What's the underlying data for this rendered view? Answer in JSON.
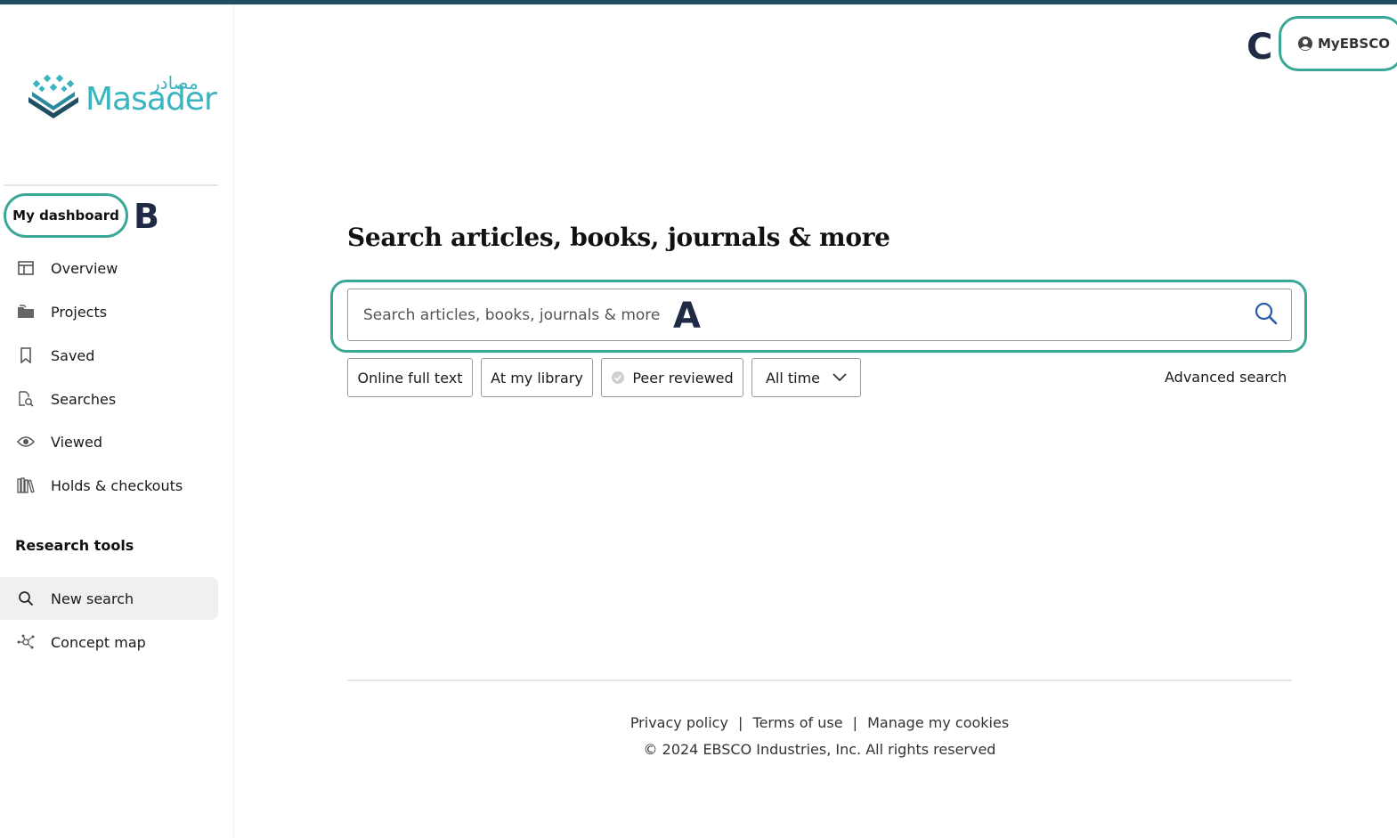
{
  "logo": {
    "arabic_text": "مصادر",
    "english_text": "Masader"
  },
  "sidebar": {
    "dashboard_label": "My dashboard",
    "items": [
      {
        "label": "Overview",
        "icon": "overview-icon"
      },
      {
        "label": "Projects",
        "icon": "folder-icon"
      },
      {
        "label": "Saved",
        "icon": "bookmark-icon"
      },
      {
        "label": "Searches",
        "icon": "search-history-icon"
      },
      {
        "label": "Viewed",
        "icon": "eye-icon"
      },
      {
        "label": "Holds & checkouts",
        "icon": "books-icon"
      }
    ],
    "research_tools_title": "Research tools",
    "tools": [
      {
        "label": "New search",
        "icon": "search-icon",
        "active": true
      },
      {
        "label": "Concept map",
        "icon": "concept-map-icon",
        "active": false
      }
    ]
  },
  "annotations": {
    "a": "A",
    "b": "B",
    "c": "C"
  },
  "header": {
    "myebsco_label": "MyEBSCO"
  },
  "main": {
    "title": "Search articles, books, journals & more",
    "search_placeholder": "Search articles, books, journals & more",
    "filters": [
      {
        "label": "Online full text"
      },
      {
        "label": "At my library"
      },
      {
        "label": "Peer reviewed"
      },
      {
        "label": "All time"
      }
    ],
    "advanced_search_label": "Advanced search"
  },
  "footer": {
    "privacy_label": "Privacy policy",
    "terms_label": "Terms of use",
    "cookies_label": "Manage my cookies",
    "separator": "|",
    "copyright": "© 2024 EBSCO Industries, Inc. All rights reserved"
  },
  "colors": {
    "accent_teal": "#3aa895",
    "logo_teal": "#3ab4bf",
    "topbar": "#1f4e63",
    "annotation_letter": "#1f2a44",
    "search_icon": "#2b5ba8"
  }
}
